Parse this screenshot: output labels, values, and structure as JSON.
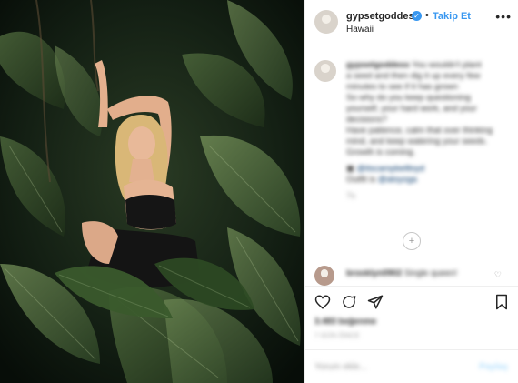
{
  "header": {
    "username": "gypsetgoddess",
    "verified_mark": "✓",
    "separator": "•",
    "follow_label": "Takip Et",
    "location": "Hawaii",
    "more_label": "•••"
  },
  "caption": {
    "username": "gypsetgoddess",
    "lines": [
      "You wouldn't plant",
      "a seed and then dig it up every few",
      "minutes to see if it has grown",
      "So why do you keep questioning",
      "yourself, your hard work, and your",
      "decisions?",
      "Have patience, calm that over thinking",
      "mind, and keep watering your seeds.",
      "Growth is coming."
    ],
    "credit_line1": "@itscampbellloyd",
    "credit_line2_prefix": "Outfit is ",
    "credit_line2_tag": "@aloyoga",
    "time_short": "7s"
  },
  "load_more_icon": "plus-circle-icon",
  "load_more_symbol": "+",
  "comment": {
    "username": "brooklyn0902",
    "text": "Single queen!"
  },
  "actions": {
    "icons": [
      "heart-icon",
      "comment-icon",
      "share-icon",
      "bookmark-icon"
    ]
  },
  "likes": "3.483 beğenme",
  "timestamp": "7 GÜN ÖNCE",
  "add_comment": {
    "placeholder": "Yorum ekle...",
    "post_label": "Paylaş"
  },
  "colors": {
    "accent": "#3897f0",
    "text": "#262626",
    "muted": "#999999",
    "border": "#efefef"
  }
}
